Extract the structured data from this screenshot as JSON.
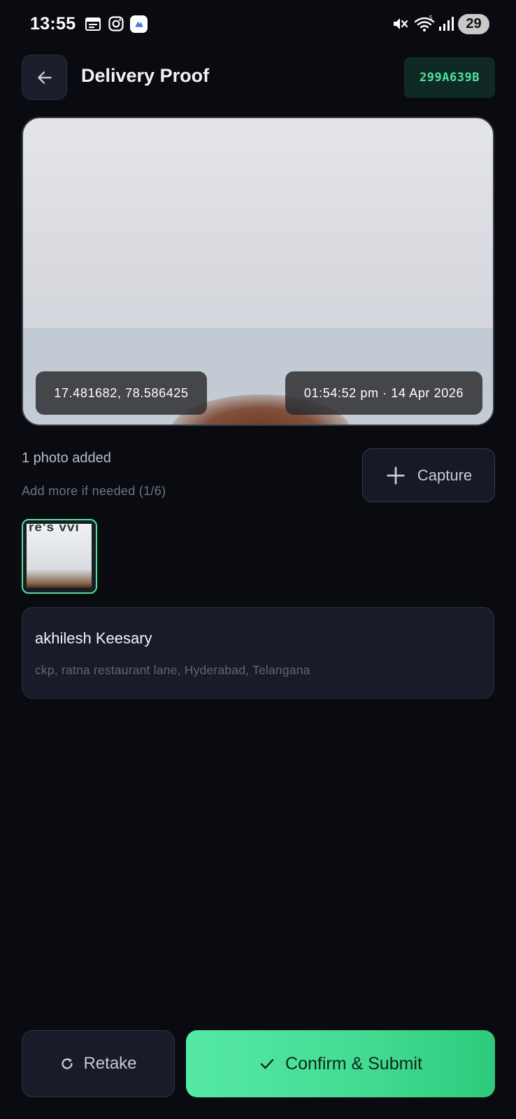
{
  "status_bar": {
    "time": "13:55",
    "battery": "29",
    "icons": [
      "calendar-icon",
      "instagram-icon",
      "app-icon",
      "mute-icon",
      "wifi-icon",
      "signal-icon"
    ]
  },
  "header": {
    "back_icon": "arrow-left-icon",
    "title": "Delivery Proof",
    "order_id": "299A639B"
  },
  "photo": {
    "coordinates": "17.481682, 78.586425",
    "timestamp": "01:54:52 pm · 14 Apr 2026"
  },
  "photo_info": {
    "count_text": "1 photo added",
    "hint_text": "Add more if needed (1/6)",
    "capture_label": "Capture"
  },
  "thumbnail": {
    "visible_text": "re's vvi"
  },
  "customer": {
    "name": "akhilesh Keesary",
    "address": "ckp, ratna restaurant lane, Hyderabad, Telangana"
  },
  "actions": {
    "retake_label": "Retake",
    "submit_label": "Confirm & Submit"
  },
  "colors": {
    "background": "#0a0b10",
    "accent": "#4ee29b",
    "card": "#181c29"
  }
}
